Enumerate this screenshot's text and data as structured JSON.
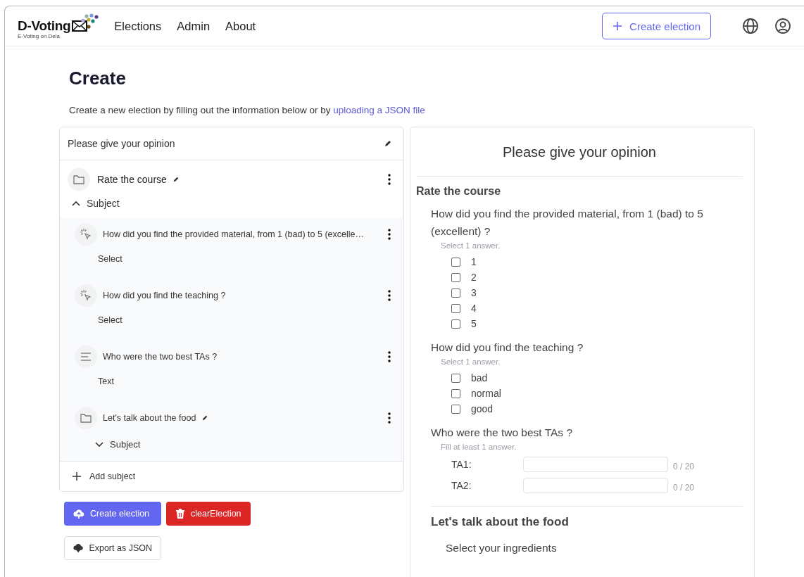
{
  "navbar": {
    "logo": {
      "title": "D-Voting",
      "subtitle": "E-Voting on Dela"
    },
    "links": [
      "Elections",
      "Admin",
      "About"
    ],
    "create_button": "Create election"
  },
  "page": {
    "title": "Create",
    "intro": "Create a new election by filling out the information below or by ",
    "intro_link": "uploading a JSON file"
  },
  "editor": {
    "election_title": "Please give your opinion",
    "subjects": [
      {
        "title": "Rate the course",
        "toggle": "Subject",
        "expanded": true,
        "children": [
          {
            "kind": "select",
            "title": "How did you find the provided material, from 1 (bad) to 5 (excelle…",
            "type_label": "Select"
          },
          {
            "kind": "select",
            "title": "How did you find the teaching ?",
            "type_label": "Select"
          },
          {
            "kind": "text",
            "title": "Who were the two best TAs ?",
            "type_label": "Text"
          },
          {
            "kind": "subject",
            "title": "Let's talk about the food",
            "toggle": "Subject",
            "expanded": false
          }
        ]
      }
    ],
    "add_subject": "Add subject"
  },
  "actions": [
    {
      "kind": "primary",
      "label": "Create election"
    },
    {
      "kind": "danger",
      "label": "clearElection"
    },
    {
      "kind": "outline",
      "label": "Export as JSON"
    }
  ],
  "preview": {
    "title": "Please give your opinion",
    "subjects": [
      {
        "title": "Rate the course",
        "questions": [
          {
            "kind": "select",
            "title": "How did you find the provided material, from 1 (bad) to 5 (excellent) ?",
            "hint": "Select 1 answer.",
            "options": [
              {
                "label": "1",
                "checked": false
              },
              {
                "label": "2",
                "checked": false
              },
              {
                "label": "3",
                "checked": false
              },
              {
                "label": "4",
                "checked": false
              },
              {
                "label": "5",
                "checked": false
              }
            ]
          },
          {
            "kind": "select",
            "title": "How did you find the teaching ?",
            "hint": "Select 1 answer.",
            "options": [
              {
                "label": "bad",
                "checked": false
              },
              {
                "label": "normal",
                "checked": false
              },
              {
                "label": "good",
                "checked": false
              }
            ]
          },
          {
            "kind": "text",
            "title": "Who were the two best TAs ?",
            "hint": "Fill at least 1 answer.",
            "fields": [
              {
                "label": "TA1:",
                "counter": "0 / 20"
              },
              {
                "label": "TA2:",
                "counter": "0 / 20"
              }
            ]
          }
        ]
      },
      {
        "title": "Let's talk about the food",
        "questions": [
          {
            "kind": "subject",
            "title": "Select your ingredients"
          }
        ]
      }
    ]
  }
}
